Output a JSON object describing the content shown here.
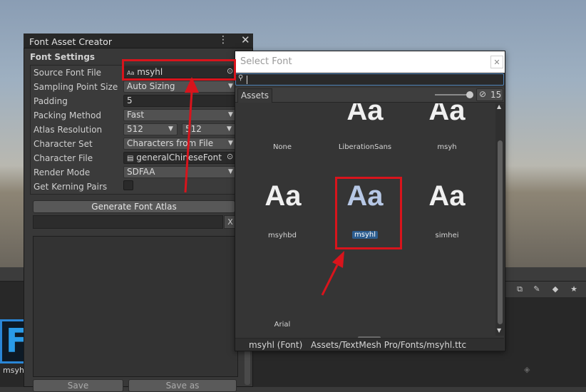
{
  "font_asset_creator": {
    "window_title": "Font Asset Creator",
    "section_header": "Font Settings",
    "rows": {
      "source_font_file": {
        "label": "Source Font File",
        "value": "msyhl",
        "icon_text": "Aa"
      },
      "sampling_point_size": {
        "label": "Sampling Point Size",
        "value": "Auto Sizing"
      },
      "padding": {
        "label": "Padding",
        "value": "5"
      },
      "packing_method": {
        "label": "Packing Method",
        "value": "Fast"
      },
      "atlas_resolution": {
        "label": "Atlas Resolution",
        "value_width": "512",
        "value_height": "512"
      },
      "character_set": {
        "label": "Character Set",
        "value": "Characters from File"
      },
      "character_file": {
        "label": "Character File",
        "value": "generalChineseFont"
      },
      "render_mode": {
        "label": "Render Mode",
        "value": "SDFAA"
      },
      "kerning": {
        "label": "Get Kerning Pairs",
        "checked": false
      }
    },
    "generate_button": "Generate Font Atlas",
    "progress_clear": "X",
    "save_button": "Save",
    "save_as_button": "Save as"
  },
  "select_font": {
    "title": "Select Font",
    "close": "✕",
    "search_value": "",
    "tab_assets": "Assets",
    "hidden_count": "15",
    "items": [
      {
        "name": "None",
        "glyph": ""
      },
      {
        "name": "LiberationSans",
        "glyph": "Aa"
      },
      {
        "name": "msyh",
        "glyph": "Aa"
      },
      {
        "name": "msyhbd",
        "glyph": "Aa"
      },
      {
        "name": "msyhl",
        "glyph": "Aa",
        "selected": true
      },
      {
        "name": "simhei",
        "glyph": "Aa"
      },
      {
        "name": "Arial",
        "glyph": ""
      }
    ],
    "status_name": "msyhl (Font)",
    "status_path": "Assets/TextMesh Pro/Fonts/msyhl.ttc"
  },
  "background": {
    "thumbnail_label": "msyhl",
    "thumbnail_glyph": "F"
  },
  "icons": [
    "kebab-menu-icon",
    "close-icon",
    "search-icon",
    "eye-slash-icon",
    "dropdown-caret-icon",
    "object-picker-icon",
    "file-icon",
    "font-file-icon"
  ],
  "colors": {
    "annotation_red": "#d8141c",
    "selection_blue": "#2c5d8f",
    "focus_blue": "#4e83b8"
  }
}
